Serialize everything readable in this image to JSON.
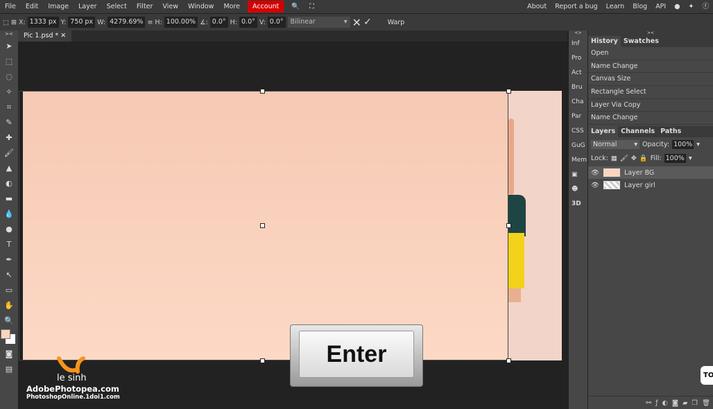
{
  "menu": [
    "File",
    "Edit",
    "Image",
    "Layer",
    "Select",
    "Filter",
    "View",
    "Window",
    "More"
  ],
  "account": "Account",
  "right_links": [
    "About",
    "Report a bug",
    "Learn",
    "Blog",
    "API"
  ],
  "options": {
    "x_label": "X:",
    "x": "1333 px",
    "y_label": "Y:",
    "y": "750 px",
    "w_label": "W:",
    "w": "4279.69%",
    "h_label": "H:",
    "h": "100.00%",
    "angle_label": "∡:",
    "angle": "0.0°",
    "hskew_label": "H:",
    "hskew": "0.0°",
    "vskew_label": "V:",
    "vskew": "0.0°",
    "interp": "Bilinear",
    "warp": "Warp"
  },
  "doc_tab": "Pic 1.psd *",
  "side_col": [
    "Inf",
    "Pro",
    "Act",
    "Bru",
    "Cha",
    "Par",
    "CSS",
    "GuG",
    "Mem"
  ],
  "history": {
    "tabs": [
      "History",
      "Swatches"
    ],
    "items": [
      "Open",
      "Name Change",
      "Canvas Size",
      "Rectangle Select",
      "Layer Via Copy",
      "Name Change"
    ]
  },
  "layers": {
    "tabs": [
      "Layers",
      "Channels",
      "Paths"
    ],
    "blend": "Normal",
    "opacity_label": "Opacity:",
    "opacity": "100%",
    "lock_label": "Lock:",
    "fill_label": "Fill:",
    "fill": "100%",
    "items": [
      "Layer BG",
      "Layer girl"
    ]
  },
  "overlay": {
    "key": "Enter",
    "brand": "le sinh",
    "site1": "AdobePhotopea.com",
    "site2": "PhotoshopOnline.1doi1.com",
    "to": "TO"
  },
  "colors": {
    "account": "#d40000",
    "canvas_bg": "#f8d0bd",
    "foreground": "#fcd4bf"
  }
}
